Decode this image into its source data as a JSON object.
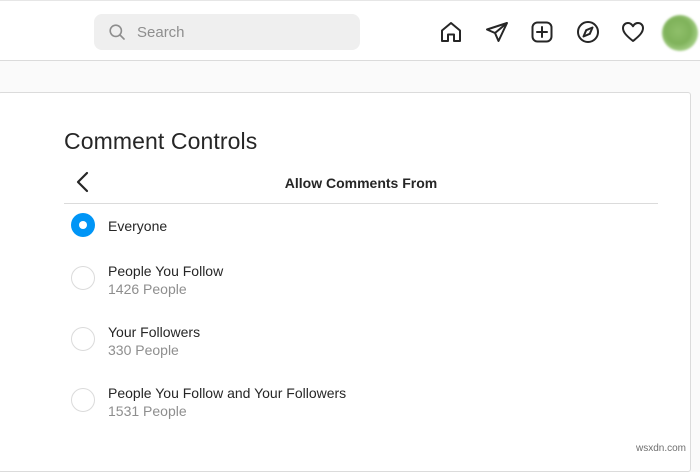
{
  "search": {
    "placeholder": "Search"
  },
  "nav": {
    "icons": [
      "home-icon",
      "direct-message-icon",
      "new-post-icon",
      "explore-icon",
      "activity-heart-icon",
      "avatar"
    ]
  },
  "page": {
    "title": "Comment Controls",
    "subtitle": "Allow Comments From"
  },
  "options": [
    {
      "label": "Everyone",
      "count": "",
      "checked": true
    },
    {
      "label": "People You Follow",
      "count": "1426 People",
      "checked": false
    },
    {
      "label": "Your Followers",
      "count": "330 People",
      "checked": false
    },
    {
      "label": "People You Follow and Your Followers",
      "count": "1531 People",
      "checked": false
    }
  ],
  "watermark": "wsxdn.com",
  "colors": {
    "accent": "#0095f6",
    "text": "#262626",
    "secondary_text": "#8e8e8e",
    "border": "#dbdbdb"
  }
}
